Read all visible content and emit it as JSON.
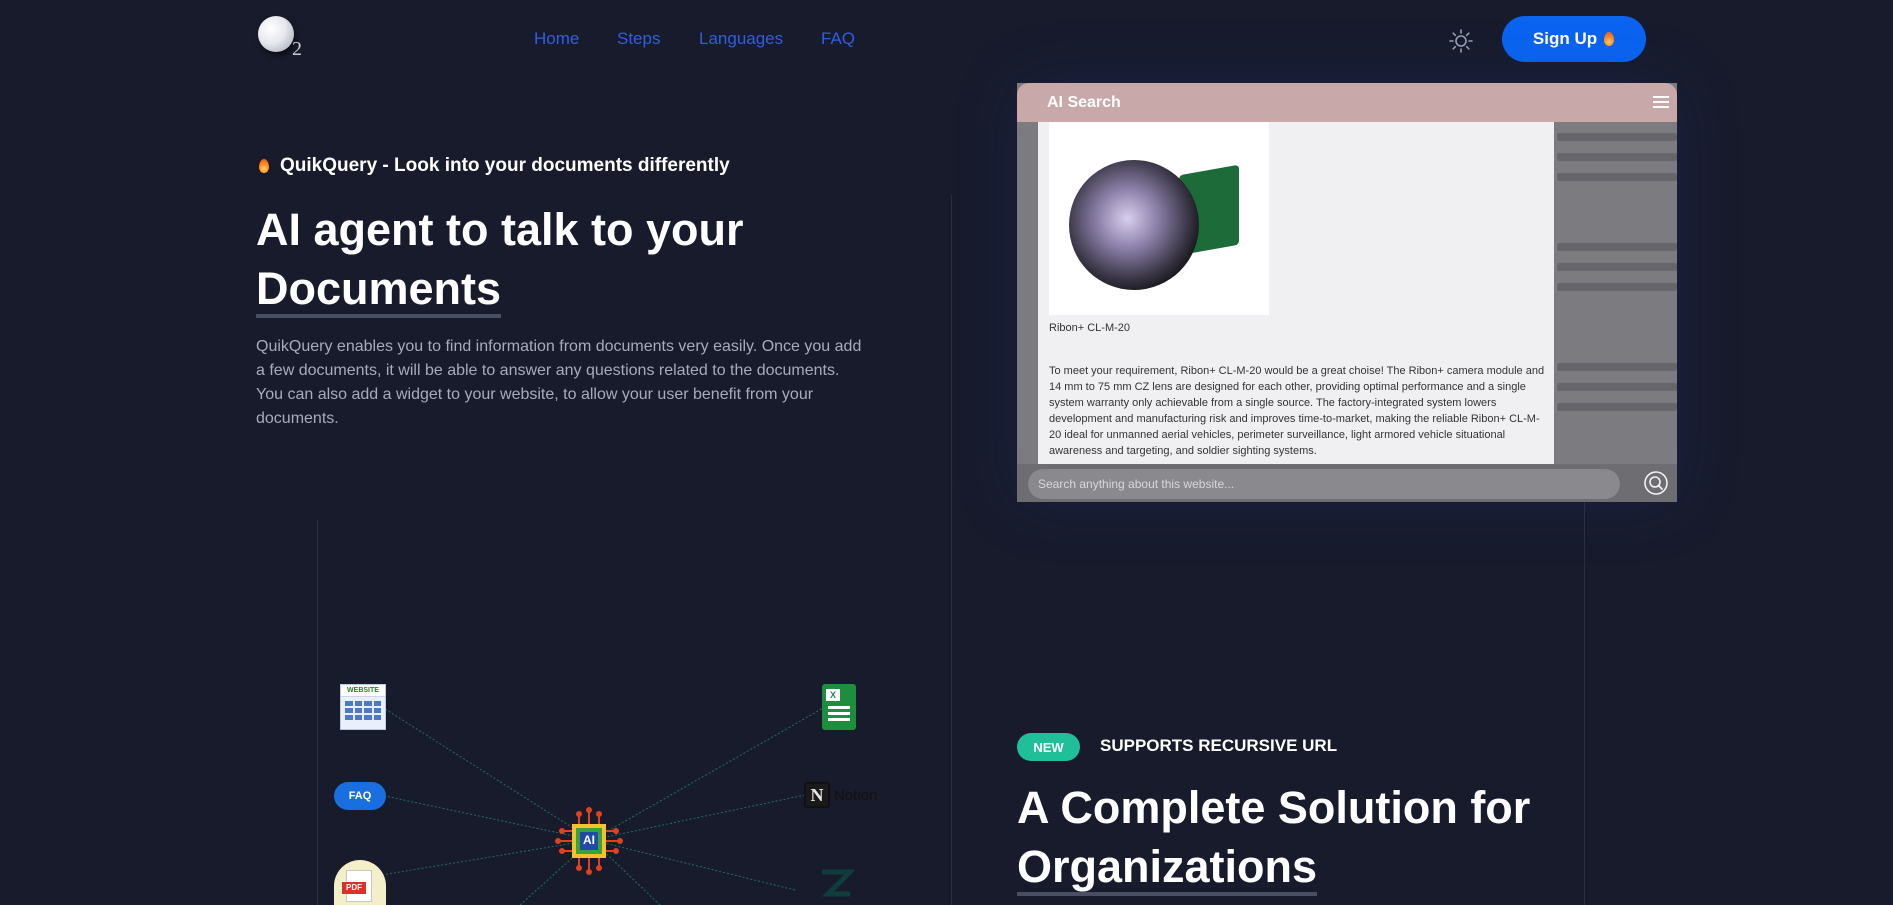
{
  "nav": {
    "logo_suffix": "2",
    "links": [
      {
        "label": "Home"
      },
      {
        "label": "Steps"
      },
      {
        "label": "Languages"
      },
      {
        "label": "FAQ"
      }
    ],
    "signup_label": "Sign Up",
    "theme_icon": "sun-icon"
  },
  "hero": {
    "eyebrow": "QuikQuery - Look into your documents differently",
    "title_line1": "AI agent to talk to your",
    "title_line2": "Documents",
    "description": "QuikQuery enables you to find information from documents very easily. Once you add a few documents, it will be able to answer any questions related to the documents. You can also add a widget to your website, to allow your user benefit from your documents."
  },
  "widget": {
    "title": "AI Search",
    "product_name": "Ribon+ CL-M-20",
    "answer": "To meet your requirement, Ribon+ CL-M-20 would be a great choise! The Ribon+ camera module and 14 mm to 75 mm CZ lens are designed for each other, providing optimal performance and a single system warranty only achievable from a single source. The factory-integrated system lowers development and manufacturing risk and improves time-to-market, making the reliable Ribon+ CL-M-20 ideal for unmanned aerial vehicles, perimeter surveillance, light armored vehicle situational awareness and targeting, and soldier sighting systems.",
    "search_placeholder": "Search anything about this website..."
  },
  "diagram": {
    "center_label": "AI",
    "nodes": [
      "website",
      "FAQ",
      "PDF",
      "X",
      "Notion"
    ],
    "website_label": "WEBSITE",
    "faq_label": "FAQ",
    "pdf_label": "PDF",
    "sheets_label": "X",
    "notion_label": "Notion"
  },
  "section2": {
    "badge": "NEW",
    "caption": "SUPPORTS RECURSIVE URL",
    "title_line1": "A Complete Solution for",
    "title_line2": "Organizations"
  }
}
